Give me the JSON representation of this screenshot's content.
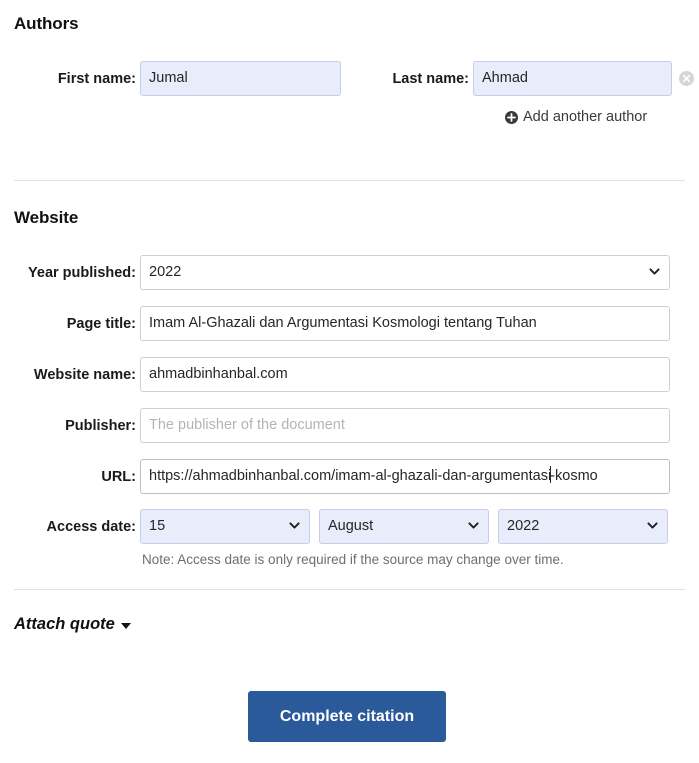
{
  "authors": {
    "heading": "Authors",
    "first_name_label": "First name:",
    "first_name_value": "Jumal",
    "last_name_label": "Last name:",
    "last_name_value": "Ahmad",
    "remove_icon": "remove-circle-icon",
    "add_author_label": "Add another author",
    "add_author_icon": "plus-circle-icon"
  },
  "website": {
    "heading": "Website",
    "year_label": "Year published:",
    "year_value": "2022",
    "page_title_label": "Page title:",
    "page_title_value": "Imam Al-Ghazali dan Argumentasi Kosmologi tentang Tuhan",
    "website_name_label": "Website name:",
    "website_name_value": "ahmadbinhanbal.com",
    "publisher_label": "Publisher:",
    "publisher_value": "",
    "publisher_placeholder": "The publisher of the document",
    "url_label": "URL:",
    "url_value_before_caret": "https://ahmadbinhanbal.com/imam-al-ghazali-dan-argumentasi",
    "url_value_after_caret": "-kosmo",
    "access_date_label": "Access date:",
    "access_day": "15",
    "access_month": "August",
    "access_year": "2022",
    "note": "Note: Access date is only required if the source may change over time."
  },
  "attach_quote": {
    "label": "Attach quote",
    "caret_icon": "chevron-down-icon"
  },
  "submit": {
    "label": "Complete citation"
  },
  "colors": {
    "button_blue": "#2b5a9b",
    "autofill_lavender": "#e8ecfb",
    "field_border": "#cfcfcf",
    "divider": "#e2e2e2",
    "placeholder_gray": "#b4b4b4",
    "note_gray": "#6e6e6e"
  }
}
